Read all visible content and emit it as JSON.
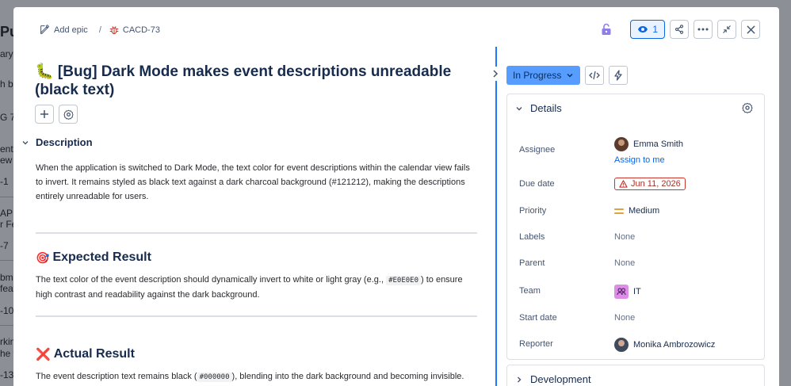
{
  "background": {
    "title_fragment": "Pu",
    "fragments": [
      "ary",
      "h b",
      "G   7",
      "ent",
      "ew",
      "-1",
      "API",
      "r Fe",
      "-7",
      "bmi",
      "feat",
      "-10",
      "rkin",
      "he v",
      "-13"
    ]
  },
  "breadcrumb": {
    "add_epic": "Add epic",
    "separator": "/",
    "issue_key": "CACD-73"
  },
  "top_actions": {
    "watch_count": "1"
  },
  "issue": {
    "title": "🐛 [Bug] Dark Mode makes event descriptions unreadable (black text)"
  },
  "description": {
    "heading": "Description",
    "body": "When the application is switched to Dark Mode, the text color for event descriptions within the calendar view fails to invert. It remains styled as black text against a dark charcoal background (#121212), making the descriptions entirely unreadable for users.",
    "expected_heading": "Expected Result",
    "expected_emoji": "🎯",
    "expected_body_1": "The text color of the event description should dynamically invert to white or light gray (e.g., ",
    "expected_code": "#E0E0E0",
    "expected_body_2": ") to ensure high contrast and readability against the dark background.",
    "actual_heading": "Actual Result",
    "actual_emoji": "❌",
    "actual_body_1": "The event description text remains black (",
    "actual_code": "#000000",
    "actual_body_2": "), blending into the dark background and becoming invisible."
  },
  "status": {
    "label": "In Progress"
  },
  "details": {
    "heading": "Details",
    "assignee_label": "Assignee",
    "assignee_name": "Emma Smith",
    "assign_to_me": "Assign to me",
    "due_label": "Due date",
    "due_value": "Jun 11, 2026",
    "priority_label": "Priority",
    "priority_value": "Medium",
    "labels_label": "Labels",
    "labels_value": "None",
    "parent_label": "Parent",
    "parent_value": "None",
    "team_label": "Team",
    "team_value": "IT",
    "start_label": "Start date",
    "start_value": "None",
    "reporter_label": "Reporter",
    "reporter_name": "Monika Ambrozowicz"
  },
  "development": {
    "heading": "Development"
  },
  "colors": {
    "accent": "#0c66e4",
    "status_bg": "#579dff",
    "danger": "#c9372c",
    "priority_medium": "#e2a03f",
    "lock": "#8f7ee7"
  }
}
